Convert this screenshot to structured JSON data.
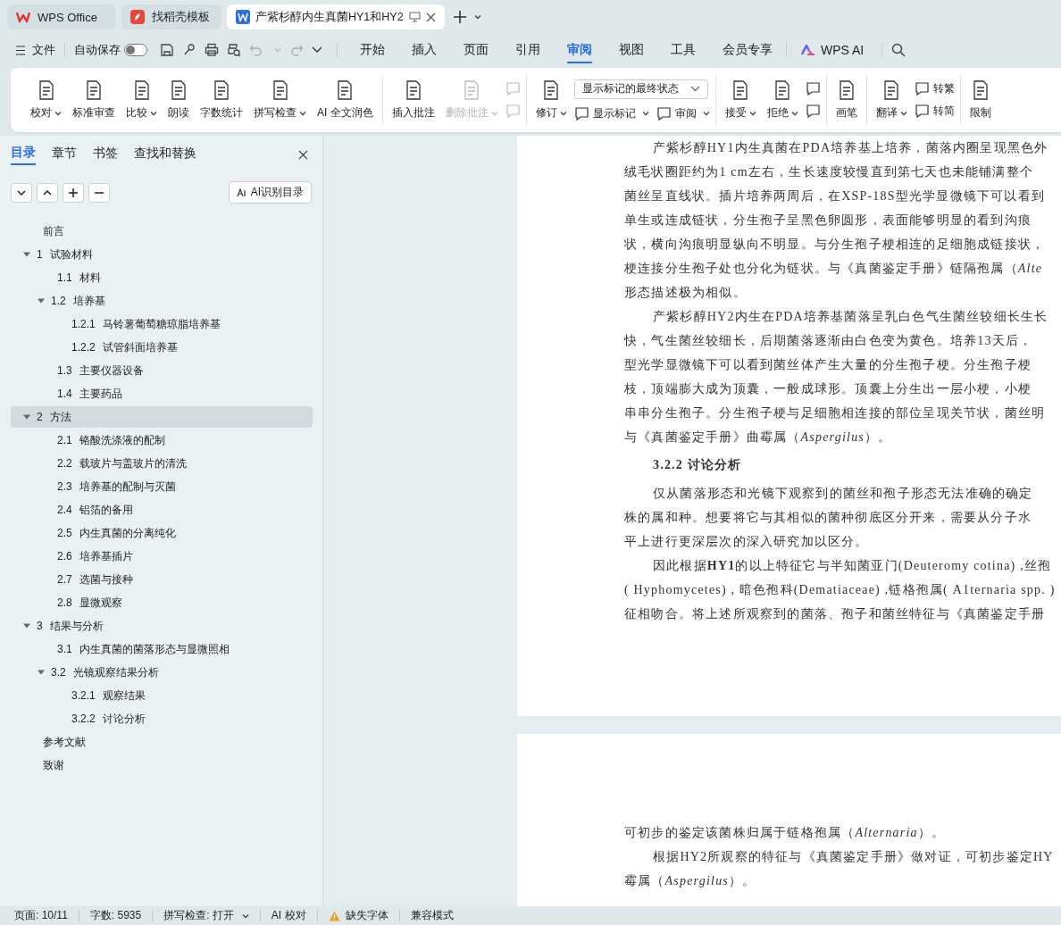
{
  "tabs": [
    {
      "label": "WPS Office",
      "kind": "home",
      "selected": false
    },
    {
      "label": "找稻壳模板",
      "kind": "template",
      "selected": false
    },
    {
      "label": "产紫杉醇内生真菌HY1和HY2",
      "kind": "document",
      "selected": true
    }
  ],
  "quickbar": {
    "file_menu": "文件",
    "autosave_label": "自动保存",
    "autosave_on": false
  },
  "ribbon_tabs": [
    {
      "label": "开始",
      "selected": false
    },
    {
      "label": "插入",
      "selected": false
    },
    {
      "label": "页面",
      "selected": false
    },
    {
      "label": "引用",
      "selected": false
    },
    {
      "label": "审阅",
      "selected": true
    },
    {
      "label": "视图",
      "selected": false
    },
    {
      "label": "工具",
      "selected": false
    },
    {
      "label": "会员专享",
      "selected": false
    }
  ],
  "ai_tab": "WPS AI",
  "ribbon": [
    {
      "items": [
        {
          "kind": "large",
          "label": "校对",
          "dropdown": true,
          "disabled": false
        },
        {
          "kind": "large",
          "label": "标准审查",
          "dropdown": false,
          "disabled": false
        },
        {
          "kind": "large",
          "label": "比较",
          "dropdown": true,
          "disabled": false
        },
        {
          "kind": "large",
          "label": "朗读",
          "dropdown": false,
          "disabled": false
        },
        {
          "kind": "large",
          "label": "字数统计",
          "dropdown": false,
          "disabled": false
        },
        {
          "kind": "large",
          "label": "拼写检查",
          "dropdown": true,
          "disabled": false
        },
        {
          "kind": "large",
          "label": "AI 全文润色",
          "dropdown": false,
          "disabled": false
        }
      ]
    },
    {
      "items": [
        {
          "kind": "large",
          "label": "插入批注",
          "dropdown": false,
          "disabled": false
        },
        {
          "kind": "large",
          "label": "删除批注",
          "dropdown": true,
          "disabled": true
        },
        {
          "kind": "stack",
          "rows": [
            [
              {
                "kind": "icon",
                "disabled": true
              }
            ],
            [
              {
                "kind": "icon",
                "disabled": true
              }
            ]
          ]
        }
      ]
    },
    {
      "items": [
        {
          "kind": "large",
          "label": "修订",
          "dropdown": true,
          "disabled": false
        },
        {
          "kind": "stack",
          "rows": [
            [
              {
                "kind": "select",
                "label": "显示标记的最终状态"
              }
            ],
            [
              {
                "kind": "small",
                "label": "显示标记",
                "dropdown": true,
                "disabled": false
              },
              {
                "kind": "small",
                "label": "审阅",
                "dropdown": true,
                "disabled": false
              }
            ]
          ]
        }
      ]
    },
    {
      "items": [
        {
          "kind": "large",
          "label": "接受",
          "dropdown": true,
          "disabled": false
        },
        {
          "kind": "large",
          "label": "拒绝",
          "dropdown": true,
          "disabled": false
        },
        {
          "kind": "stack",
          "rows": [
            [
              {
                "kind": "icon",
                "disabled": false
              }
            ],
            [
              {
                "kind": "icon",
                "disabled": false
              }
            ]
          ]
        }
      ]
    },
    {
      "items": [
        {
          "kind": "large",
          "label": "画笔",
          "dropdown": false,
          "disabled": false
        }
      ]
    },
    {
      "items": [
        {
          "kind": "large",
          "label": "翻译",
          "dropdown": true,
          "disabled": false
        },
        {
          "kind": "stack",
          "rows": [
            [
              {
                "kind": "small",
                "label": "转繁",
                "dropdown": false,
                "disabled": false
              }
            ],
            [
              {
                "kind": "small",
                "label": "转简",
                "dropdown": false,
                "disabled": false
              }
            ]
          ]
        }
      ]
    },
    {
      "items": [
        {
          "kind": "large",
          "label": "限制",
          "dropdown": false,
          "disabled": false
        }
      ]
    }
  ],
  "nav": {
    "tabs": [
      {
        "label": "目录",
        "selected": true
      },
      {
        "label": "章节",
        "selected": false
      },
      {
        "label": "书签",
        "selected": false
      },
      {
        "label": "查找和替换",
        "selected": false
      }
    ],
    "ai_button": "AI识别目录",
    "toc": [
      {
        "title": "前言",
        "selected": false
      },
      {
        "number": "1",
        "title": "试验材料",
        "expanded": true,
        "selected": false,
        "children": [
          {
            "number": "1.1",
            "title": "材料",
            "selected": false
          },
          {
            "number": "1.2",
            "title": "培养基",
            "expanded": true,
            "selected": false,
            "children": [
              {
                "number": "1.2.1",
                "title": "马铃薯葡萄糖琼脂培养基",
                "selected": false
              },
              {
                "number": "1.2.2",
                "title": "试管斜面培养基",
                "selected": false
              }
            ]
          },
          {
            "number": "1.3",
            "title": "主要仪器设备",
            "selected": false
          },
          {
            "number": "1.4",
            "title": "主要药品",
            "selected": false
          }
        ]
      },
      {
        "number": "2",
        "title": "方法",
        "expanded": true,
        "selected": true,
        "children": [
          {
            "number": "2.1",
            "title": "铬酸洗涤液的配制",
            "selected": false
          },
          {
            "number": "2.2",
            "title": "载玻片与盖玻片的清洗",
            "selected": false
          },
          {
            "number": "2.3",
            "title": "培养基的配制与灭菌",
            "selected": false
          },
          {
            "number": "2.4",
            "title": "铝箔的备用",
            "selected": false
          },
          {
            "number": "2.5",
            "title": "内生真菌的分离纯化",
            "selected": false
          },
          {
            "number": "2.6",
            "title": "培养基插片",
            "selected": false
          },
          {
            "number": "2.7",
            "title": "选菌与接种",
            "selected": false
          },
          {
            "number": "2.8",
            "title": "显微观察",
            "selected": false
          }
        ]
      },
      {
        "number": "3",
        "title": "结果与分析",
        "expanded": true,
        "selected": false,
        "children": [
          {
            "number": "3.1",
            "title": "内生真菌的菌落形态与显微照相",
            "selected": false
          },
          {
            "number": "3.2",
            "title": "光镜观察结果分析",
            "expanded": true,
            "selected": false,
            "children": [
              {
                "number": "3.2.1",
                "title": "观察结果",
                "selected": false
              },
              {
                "number": "3.2.2",
                "title": "讨论分析",
                "selected": false
              }
            ]
          }
        ]
      },
      {
        "title": "参考文献",
        "selected": false
      },
      {
        "title": "致谢",
        "selected": false
      }
    ]
  },
  "pages": [
    {
      "lines": [
        {
          "kind": "first",
          "text": "产紫杉醇HY1内生真菌在PDA培养基上培养，菌落内圈呈现黑色外"
        },
        {
          "kind": "line",
          "text": "绒毛状圈距约为1 cm左右，生长速度较慢直到第七天也未能铺满整个"
        },
        {
          "kind": "line",
          "text": "菌丝呈直线状。插片培养两周后，在XSP-18S型光学显微镜下可以看到"
        },
        {
          "kind": "line",
          "text": "单生或连成链状，分生孢子呈黑色卵圆形，表面能够明显的看到沟痕"
        },
        {
          "kind": "line",
          "text": "状，横向沟痕明显纵向不明显。与分生孢子梗相连的足细胞成链接状，"
        },
        {
          "kind": "line",
          "text": "梗连接分生孢子处也分化为链状。与《真菌鉴定手册》链隔孢属（*Alte*"
        },
        {
          "kind": "line",
          "text": "形态描述极为相似。"
        },
        {
          "kind": "first",
          "text": "产紫杉醇HY2内生在PDA培养基菌落呈乳白色气生菌丝较细长生长"
        },
        {
          "kind": "line",
          "text": "快，气生菌丝较细长，后期菌落逐渐由白色变为黄色。培养13天后，"
        },
        {
          "kind": "line",
          "text": "型光学显微镜下可以看到菌丝体产生大量的分生孢子梗。分生孢子梗"
        },
        {
          "kind": "line",
          "text": "枝，顶端膨大成为顶囊，一般成球形。顶囊上分生出一层小梗，小梗"
        },
        {
          "kind": "line",
          "text": "串串分生孢子。分生孢子梗与足细胞相连接的部位呈现关节状，菌丝明"
        },
        {
          "kind": "line",
          "text": "与《真菌鉴定手册》曲霉属（*Aspergilus*）。"
        },
        {
          "kind": "heading",
          "text": "3.2.2 讨论分析"
        },
        {
          "kind": "first",
          "text": "仅从菌落形态和光镜下观察到的菌丝和孢子形态无法准确的确定"
        },
        {
          "kind": "line",
          "text": "株的属和种。想要将它与其相似的菌种彻底区分开来，需要从分子水"
        },
        {
          "kind": "line",
          "text": "平上进行更深层次的深入研究加以区分。"
        },
        {
          "kind": "first",
          "text": "因此根据**HY1**的以上特征它与半知菌亚门(Deuteromy cotina) ,丝孢"
        },
        {
          "kind": "line",
          "text": "( Hyphomycetes) , 暗色孢科(Dematiaceae) ,链格孢属( A1ternaria spp. )"
        },
        {
          "kind": "line",
          "text": "征相吻合。将上述所观察到的菌落、孢子和菌丝特征与《真菌鉴定手册"
        }
      ]
    },
    {
      "lines": [
        {
          "kind": "line",
          "text": "可初步的鉴定该菌株归属于链格孢属（*Alternaria*）。"
        },
        {
          "kind": "first",
          "text": "根据HY2所观察的特征与《真菌鉴定手册》做对证，可初步鉴定HY"
        },
        {
          "kind": "line",
          "text": "霉属（*Aspergilus*）。"
        }
      ]
    }
  ],
  "status_bar": [
    {
      "kind": "text",
      "label": "页面: 10/11"
    },
    {
      "kind": "text",
      "label": "字数: 5935"
    },
    {
      "kind": "menu",
      "label": "拼写检查: 打开"
    },
    {
      "kind": "text",
      "label": "AI 校对"
    },
    {
      "kind": "warning",
      "label": "缺失字体"
    },
    {
      "kind": "text",
      "label": "兼容模式"
    }
  ]
}
